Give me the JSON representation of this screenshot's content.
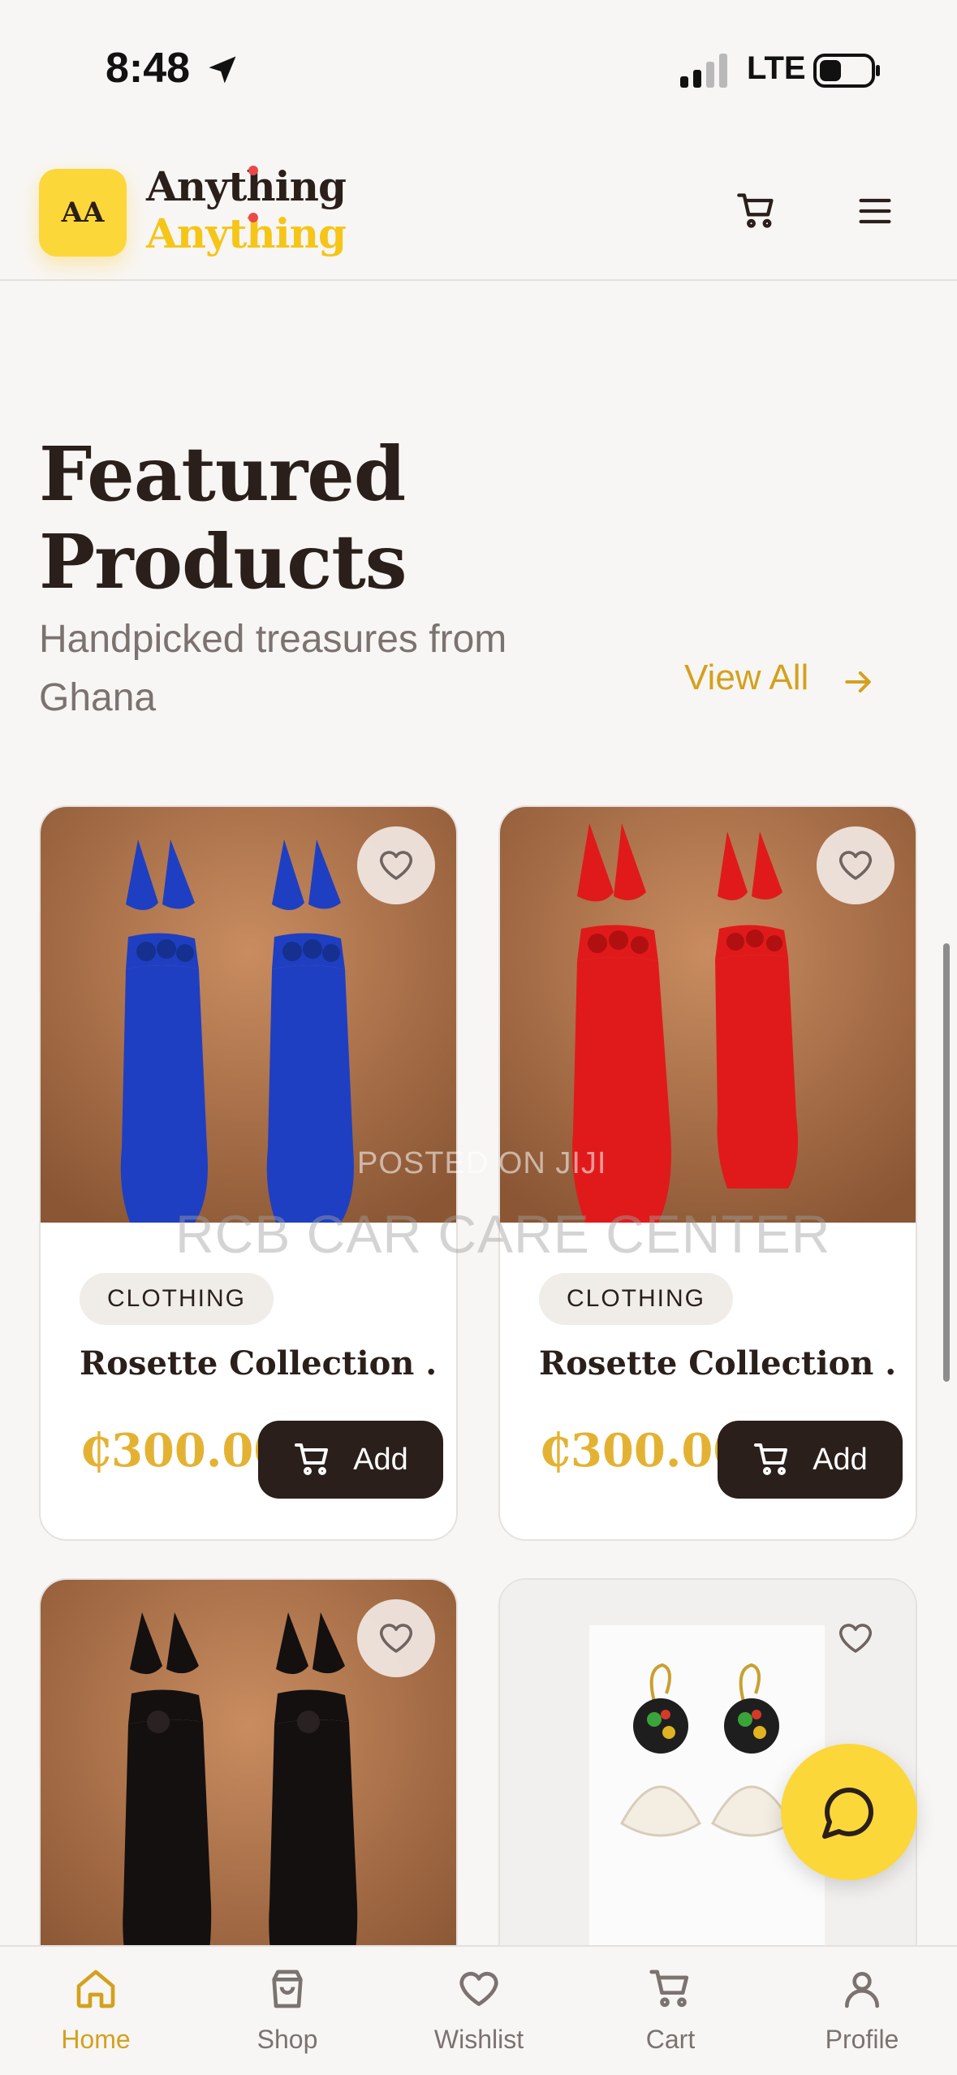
{
  "status": {
    "time": "8:48",
    "network": "LTE"
  },
  "header": {
    "logo_initials": "AA",
    "brand_line1": "Anything",
    "brand_line2": "Anything"
  },
  "section": {
    "title_line1": "Featured",
    "title_line2": "Products",
    "subtitle": "Handpicked treasures from Ghana",
    "view_all": "View All"
  },
  "products": [
    {
      "category": "CLOTHING",
      "name": "Rosette Collection ...",
      "price": "₵300.00",
      "add_label": "Add"
    },
    {
      "category": "CLOTHING",
      "name": "Rosette Collection ...",
      "price": "₵300.00",
      "add_label": "Add"
    },
    {
      "category": "",
      "name": "",
      "price": "",
      "add_label": ""
    },
    {
      "category": "",
      "name": "",
      "price": "",
      "add_label": ""
    }
  ],
  "watermark": {
    "line1": "POSTED ON JIJI",
    "line2": "RCB CAR CARE CENTER"
  },
  "bottom_nav": [
    {
      "label": "Home",
      "icon": "home-icon",
      "active": true
    },
    {
      "label": "Shop",
      "icon": "bag-icon",
      "active": false
    },
    {
      "label": "Wishlist",
      "icon": "heart-icon",
      "active": false
    },
    {
      "label": "Cart",
      "icon": "cart-icon",
      "active": false
    },
    {
      "label": "Profile",
      "icon": "user-icon",
      "active": false
    }
  ],
  "colors": {
    "accent": "#d4a11e",
    "brand_yellow": "#fcd73a",
    "dark": "#2a1f1a",
    "price": "#e4b233"
  }
}
